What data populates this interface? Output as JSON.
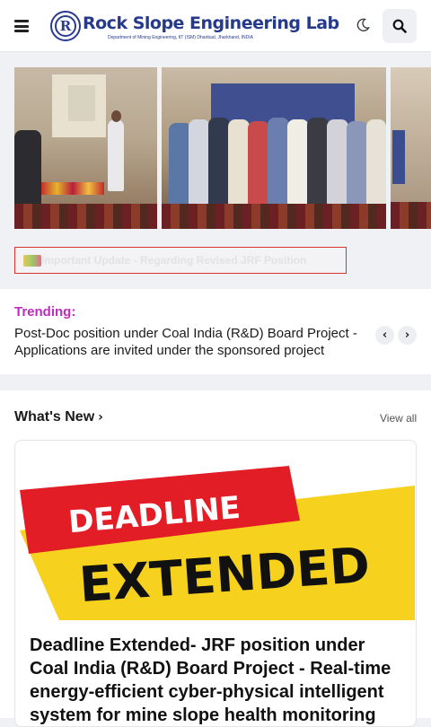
{
  "header": {
    "logo_title": "Rock Slope Engineering Lab",
    "logo_subtitle": "Department of Mining Engineering, IIT (ISM) Dhanbad, Jharkhand, INDIA",
    "icons": [
      "menu-icon",
      "moon-icon",
      "search-icon"
    ]
  },
  "update": {
    "text": "Important Update - Regarding Revised JRF Position"
  },
  "trending": {
    "label": "Trending:",
    "headline": "Post-Doc position under Coal India (R&D) Board Project - Applications are invited under the sponsored project",
    "prev_icon": "‹",
    "next_icon": "›"
  },
  "whats_new": {
    "title": "What's New",
    "chevron": "›",
    "view_all": "View all",
    "card": {
      "banner_top": "DEADLINE",
      "banner_bottom": "EXTENDED",
      "title": "Deadline Extended- JRF position under Coal India (R&D) Board Project - Real-time energy-efficient cyber-physical intelligent system for mine slope health monitoring"
    }
  },
  "colors": {
    "brand": "#263a8c",
    "trending": "#c02bbf",
    "update_border": "#d9342b",
    "banner_red": "#e21d26",
    "banner_yellow": "#f6d21e"
  }
}
